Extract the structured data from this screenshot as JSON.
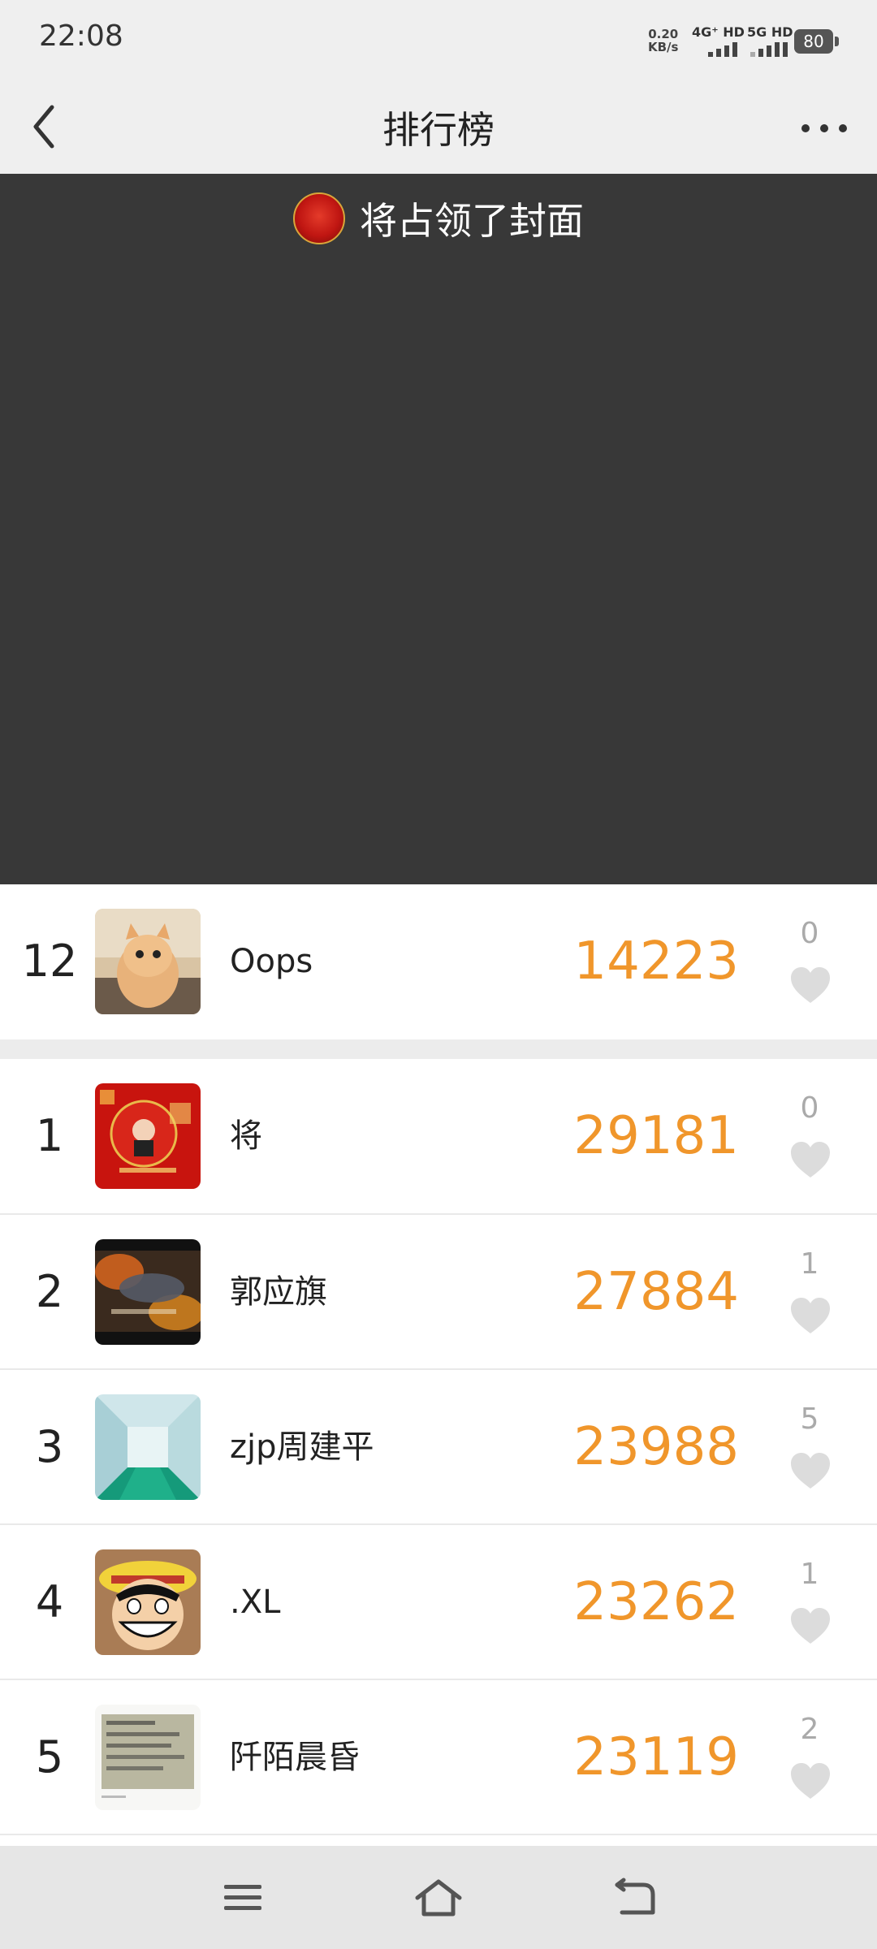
{
  "status_bar": {
    "time": "22:08",
    "net_speed_value": "0.20",
    "net_speed_unit": "KB/s",
    "sim1": "4G⁺ HD",
    "sim2": "5G HD",
    "battery": "80"
  },
  "header": {
    "title": "排行榜",
    "back_icon": "chevron-left-icon",
    "more_icon": "more-dots-icon"
  },
  "cover": {
    "caption": "将占领了封面"
  },
  "my_entry": {
    "rank": "12",
    "name": "Oops",
    "score": "14223",
    "likes": "0"
  },
  "leaderboard": [
    {
      "rank": "1",
      "name": "将",
      "score": "29181",
      "likes": "0"
    },
    {
      "rank": "2",
      "name": "郭应旗",
      "score": "27884",
      "likes": "1"
    },
    {
      "rank": "3",
      "name": "zjp周建平",
      "score": "23988",
      "likes": "5"
    },
    {
      "rank": "4",
      "name": ".XL",
      "score": "23262",
      "likes": "1"
    },
    {
      "rank": "5",
      "name": "阡陌晨昏",
      "score": "23119",
      "likes": "2"
    }
  ],
  "colors": {
    "score": "#f0962b",
    "cover_bg": "#383838",
    "heart": "#dcdcdc"
  },
  "system_nav": {
    "menu_icon": "menu-icon",
    "home_icon": "home-icon",
    "back_icon": "back-icon"
  }
}
